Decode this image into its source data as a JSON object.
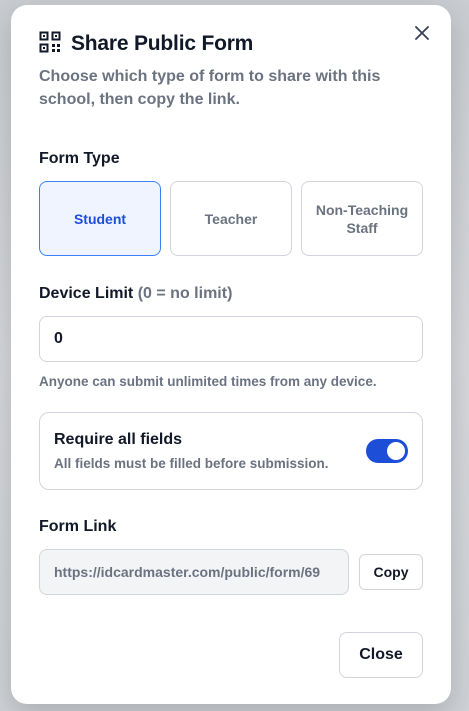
{
  "modal": {
    "title": "Share Public Form",
    "subtitle": "Choose which type of form to share with this school, then copy the link.",
    "close_icon": "close-icon",
    "title_icon": "qr-code-icon"
  },
  "form_type": {
    "label": "Form Type",
    "options": [
      "Student",
      "Teacher",
      "Non-Teaching Staff"
    ],
    "selected": "Student"
  },
  "device_limit": {
    "label": "Device Limit",
    "label_note": "(0 = no limit)",
    "value": "0",
    "hint": "Anyone can submit unlimited times from any device."
  },
  "require_fields": {
    "title": "Require all fields",
    "description": "All fields must be filled before submission.",
    "enabled": true
  },
  "form_link": {
    "label": "Form Link",
    "value": "https://idcardmaster.com/public/form/69",
    "copy_label": "Copy"
  },
  "footer": {
    "close_label": "Close"
  },
  "colors": {
    "accent": "#1d4ed8",
    "active_bg": "#eff4ff",
    "muted_text": "#6b7280"
  }
}
